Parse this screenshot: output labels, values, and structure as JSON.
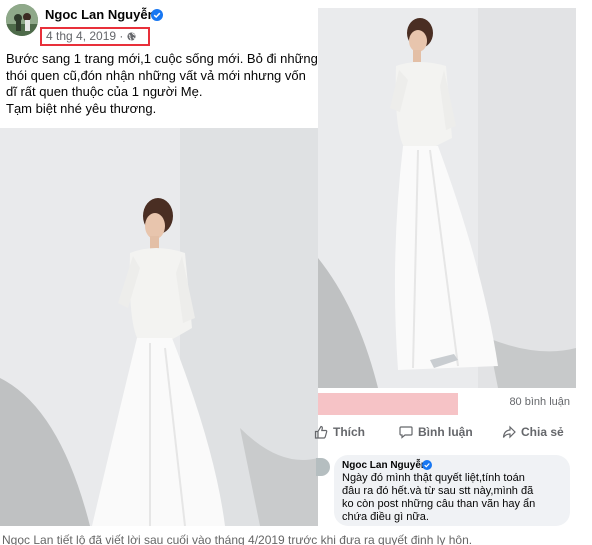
{
  "post": {
    "author": "Ngoc Lan Nguyễn",
    "date": "4 thg 4, 2019 · ",
    "text_lines": [
      "Bước sang 1 trang mới,1 cuộc sống mới. Bỏ đi những",
      "thói quen cũ,đón nhận những vất vả mới nhưng vốn",
      "dĩ rất quen thuộc của 1 người Mẹ.",
      "Tạm biệt nhé yêu thương."
    ]
  },
  "footer": {
    "comment_count": "80 bình luận",
    "like_label": "Thích",
    "comment_label": "Bình luận",
    "share_label": "Chia sẻ"
  },
  "comment": {
    "author": "Ngoc Lan Nguyễn",
    "text_lines": [
      "Ngày đó mình thật quyết liệt,tính toán",
      "đâu ra đó hết.và từ sau stt này,mình đã",
      "ko còn post những câu than vãn hay ẩn",
      "chứa điều gì nữa."
    ]
  },
  "caption": "Ngọc Lan tiết lộ đã viết lời sau cuối vào tháng 4/2019 trước khi đưa ra quyết định ly hôn.",
  "colors": {
    "highlight_box": "#e8303a",
    "verified_badge": "#1877f2",
    "redaction_bar": "#f6c3c6"
  },
  "icons": [
    "verified-icon",
    "globe-icon",
    "like-icon",
    "comment-icon",
    "share-icon"
  ]
}
